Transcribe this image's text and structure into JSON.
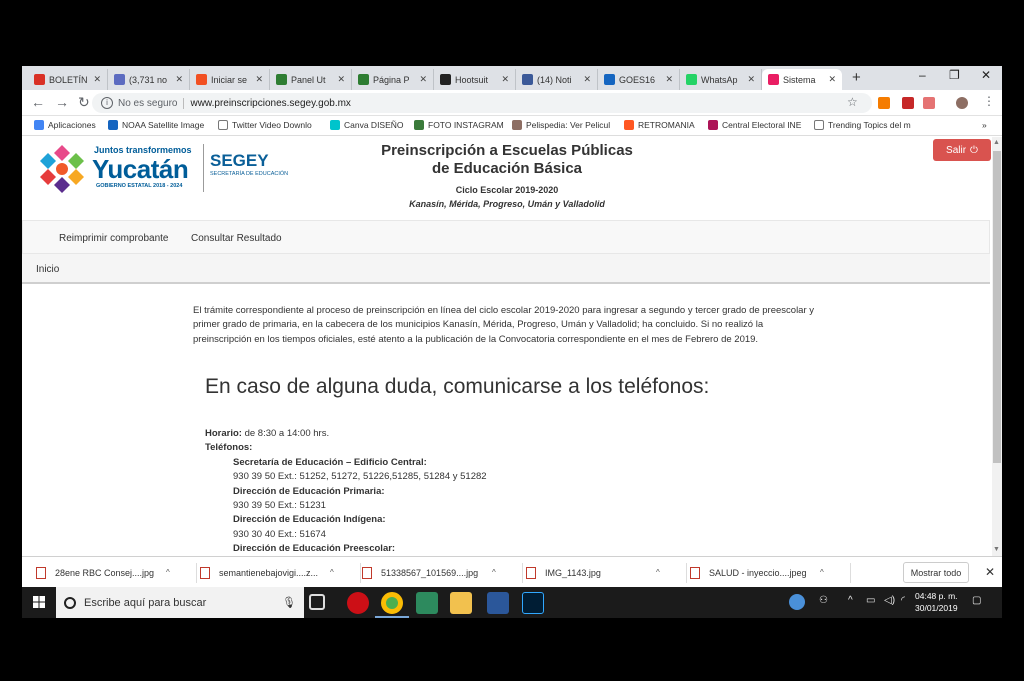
{
  "browser": {
    "tabs": [
      {
        "label": "BOLETÍN",
        "icon": "gmail-icon",
        "color": "#d93025"
      },
      {
        "label": "(3,731 no",
        "icon": "mail-icon",
        "color": "#5c6bc0"
      },
      {
        "label": "Iniciar se",
        "icon": "windows-icon",
        "color": "#f25022"
      },
      {
        "label": "Panel Ut",
        "icon": "panel-icon",
        "color": "#2e7d32"
      },
      {
        "label": "Página P",
        "icon": "page-icon",
        "color": "#2e7d32"
      },
      {
        "label": "Hootsuit",
        "icon": "hootsuite-icon",
        "color": "#222222"
      },
      {
        "label": "(14) Noti",
        "icon": "facebook-icon",
        "color": "#3b5998"
      },
      {
        "label": "GOES16",
        "icon": "noaa-icon",
        "color": "#1565c0"
      },
      {
        "label": "WhatsAp",
        "icon": "whatsapp-icon",
        "color": "#25d366"
      },
      {
        "label": "Sistema",
        "icon": "sistema-icon",
        "color": "#e91e63"
      }
    ],
    "new_tab": "+",
    "window_controls": {
      "minimize": "–",
      "maximize": "❐",
      "close": "✕"
    },
    "security": "No es seguro",
    "url": "www.preinscripciones.segey.gob.mx",
    "bookmarks": [
      {
        "label": "Aplicaciones",
        "icon": "apps-icon",
        "color": "#4285f4"
      },
      {
        "label": "NOAA Satellite Image",
        "icon": "noaa-icon",
        "color": "#1565c0"
      },
      {
        "label": "Twitter Video Downlo",
        "icon": "page-icon",
        "color": "#ffffff"
      },
      {
        "label": "Canva DISEÑO",
        "icon": "canva-icon",
        "color": "#00c4cc"
      },
      {
        "label": "FOTO INSTAGRAM",
        "icon": "instagram-icon",
        "color": "#3a7a3a"
      },
      {
        "label": "Pelispedia: Ver Pelicul",
        "icon": "film-icon",
        "color": "#8d6e63"
      },
      {
        "label": "RETROMANIA",
        "icon": "blogger-icon",
        "color": "#ff5722"
      },
      {
        "label": "Central Electoral INE",
        "icon": "ine-icon",
        "color": "#ad1457"
      },
      {
        "label": "Trending Topics del m",
        "icon": "page-icon",
        "color": "#ffffff"
      }
    ],
    "more_bookmarks": "»"
  },
  "page": {
    "logo": {
      "tagline": "Juntos transformemos",
      "name": "Yucatán",
      "subline": "GOBIERNO ESTATAL 2018 - 2024",
      "segey": "SEGEY",
      "segey_sub": "SECRETARÍA DE EDUCACIÓN"
    },
    "title_line1": "Preinscripción a Escuelas Públicas",
    "title_line2": "de Educación Básica",
    "cycle": "Ciclo Escolar 2019-2020",
    "municipalities": "Kanasín, Mérida, Progreso, Umán y Valladolid",
    "logout_label": "Salir",
    "nav": [
      "Reimprimir comprobante",
      "Consultar Resultado"
    ],
    "breadcrumb": "Inicio",
    "intro": "El trámite correspondiente al proceso de preinscripción en línea del ciclo escolar 2019-2020 para ingresar a segundo y tercer grado de preescolar y primer grado de primaria, en la cabecera de los municipios Kanasín, Mérida, Progreso, Umán y Valladolid; ha concluido. Si no realizó la preinscripción en los tiempos oficiales, esté atento a la publicación de la Convocatoria correspondiente en el mes de Febrero de 2019.",
    "heading": "En caso de alguna duda, comunicarse a los teléfonos:",
    "schedule_label": "Horario:",
    "schedule_value": " de 8:30 a 14:00 hrs.",
    "phones_label": "Teléfonos:",
    "contacts": [
      {
        "name": "Secretaría de Educación – Edificio Central:",
        "phone": "930 39 50 Ext.: 51252, 51272, 51226,51285, 51284 y 51282"
      },
      {
        "name": "Dirección de Educación Primaria:",
        "phone": "930 39 50 Ext.: 51231"
      },
      {
        "name": "Dirección de Educación Indígena:",
        "phone": "930 30 40 Ext.: 51674"
      },
      {
        "name": "Dirección de Educación Preescolar:",
        "phone": ""
      }
    ]
  },
  "downloads": {
    "items": [
      {
        "label": "28ene RBC Consej....jpg"
      },
      {
        "label": "semantienebajovigi....z..."
      },
      {
        "label": "51338567_101569....jpg"
      },
      {
        "label": "IMG_1143.jpg"
      },
      {
        "label": "SALUD - inyeccio....jpeg"
      }
    ],
    "show_all": "Mostrar todo",
    "close": "✕"
  },
  "taskbar": {
    "search_placeholder": "Escribe aquí para buscar",
    "time": "04:48 p. m.",
    "date": "30/01/2019"
  }
}
